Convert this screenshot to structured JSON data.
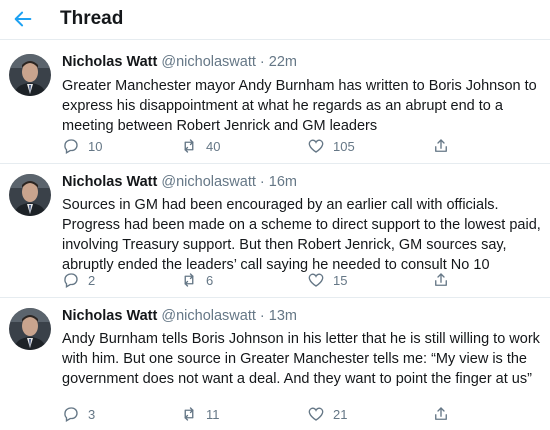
{
  "header": {
    "title": "Thread",
    "back_icon": "arrow-left-icon",
    "accent_color": "#1da1f2"
  },
  "tweets": [
    {
      "author": "Nicholas Watt",
      "handle": "@nicholaswatt",
      "separator": "·",
      "time": "22m",
      "text": "Greater Manchester mayor Andy Burnham has written to Boris Johnson to express his disappointment at what he regards as an abrupt end to a meeting between Robert Jenrick and GM leaders",
      "replies": "10",
      "retweets": "40",
      "likes": "105"
    },
    {
      "author": "Nicholas Watt",
      "handle": "@nicholaswatt",
      "separator": "·",
      "time": "16m",
      "text": "Sources in GM had been encouraged by an earlier call with officials. Progress had been made on a scheme to direct support to the lowest paid, involving Treasury support. But then Robert Jenrick, GM sources say, abruptly ended the leaders’ call saying he needed to consult No 10",
      "replies": "2",
      "retweets": "6",
      "likes": "15"
    },
    {
      "author": "Nicholas Watt",
      "handle": "@nicholaswatt",
      "separator": "·",
      "time": "13m",
      "text": "Andy Burnham tells Boris Johnson in his letter that he is still willing to work with him. But one source in Greater Manchester tells me: “My view is the government does not want a deal. And they want to point the finger at us”",
      "replies": "3",
      "retweets": "11",
      "likes": "21"
    }
  ]
}
